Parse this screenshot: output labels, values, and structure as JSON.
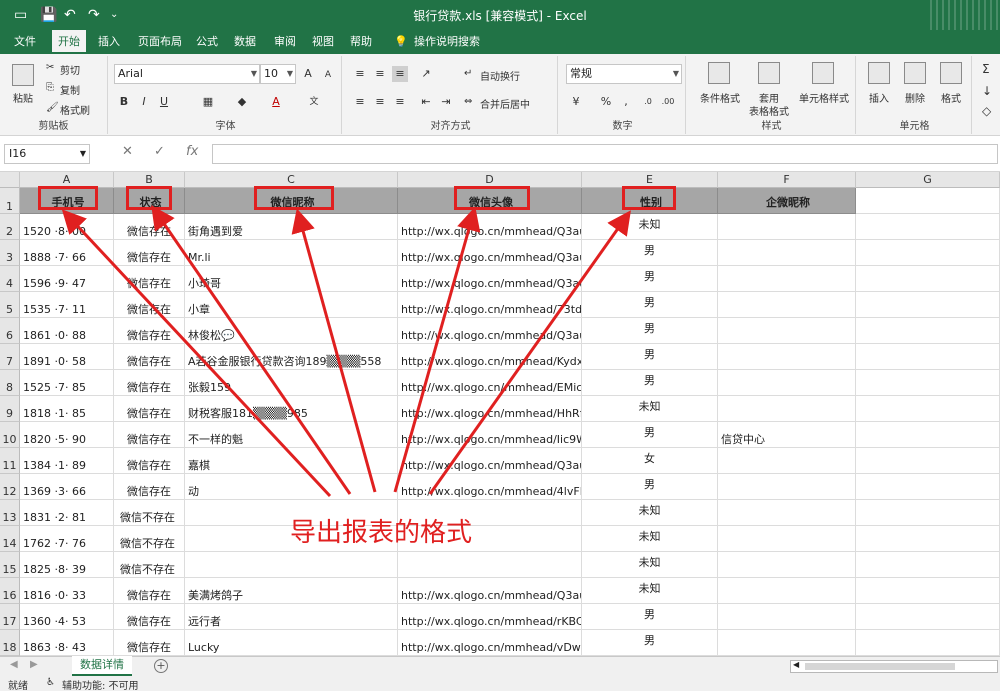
{
  "titlebar": {
    "title": "银行贷款.xls [兼容模式] - Excel"
  },
  "menu": {
    "tabs": [
      "文件",
      "开始",
      "插入",
      "页面布局",
      "公式",
      "数据",
      "审阅",
      "视图",
      "帮助"
    ],
    "active": "开始",
    "tell_me": "操作说明搜索"
  },
  "ribbon": {
    "clipboard": {
      "paste": "粘贴",
      "cut": "剪切",
      "copy": "复制",
      "format_painter": "格式刷",
      "label": "剪贴板"
    },
    "font": {
      "family": "Arial",
      "size": "10",
      "grow": "A",
      "shrink": "A",
      "bold": "B",
      "italic": "I",
      "underline": "U",
      "label": "字体"
    },
    "alignment": {
      "wrap": "自动换行",
      "merge": "合并后居中",
      "label": "对齐方式"
    },
    "number": {
      "format": "常规",
      "label": "数字"
    },
    "styles": {
      "conditional": "条件格式",
      "table_line1": "套用",
      "table_line2": "表格格式",
      "cell_styles": "单元格样式",
      "label": "样式"
    },
    "cells": {
      "insert": "插入",
      "delete": "删除",
      "format": "格式",
      "label": "单元格"
    }
  },
  "formula_bar": {
    "name_box": "I16",
    "cancel": "✕",
    "confirm": "✓",
    "fx": "fx",
    "value": ""
  },
  "grid": {
    "columns": [
      "A",
      "B",
      "C",
      "D",
      "E",
      "F",
      "G"
    ],
    "headers": [
      "手机号",
      "状态",
      "微信昵称",
      "微信头像",
      "性别",
      "企微昵称"
    ],
    "header_row": "1",
    "rows": [
      {
        "n": "2",
        "phone": "1520 ·8· 00",
        "status": "微信存在",
        "nick": "街角遇到爱",
        "avatar": "http://wx.qlogo.cn/mmhead/Q3auHgz",
        "gender": "未知",
        "wecom": ""
      },
      {
        "n": "3",
        "phone": "1888 ·7· 66",
        "status": "微信存在",
        "nick": "Mr.li",
        "avatar": "http://wx.qlogo.cn/mmhead/Q3auHgz",
        "gender": "男",
        "wecom": ""
      },
      {
        "n": "4",
        "phone": "1596 ·9· 47",
        "status": "微信存在",
        "nick": "小琦哥",
        "avatar": "http://wx.qlogo.cn/mmhead/Q3auHgz",
        "gender": "男",
        "wecom": ""
      },
      {
        "n": "5",
        "phone": "1535 ·7· 11",
        "status": "微信存在",
        "nick": "小章",
        "avatar": "http://wx.qlogo.cn/mmhead/73tdPWic",
        "gender": "男",
        "wecom": ""
      },
      {
        "n": "6",
        "phone": "1861 ·0· 88",
        "status": "微信存在",
        "nick": "林俊松💬",
        "avatar": "http://wx.qlogo.cn/mmhead/Q3auHgz",
        "gender": "男",
        "wecom": ""
      },
      {
        "n": "7",
        "phone": "1891 ·0· 58",
        "status": "微信存在",
        "nick": "A若谷金服银行贷款咨询189▒▒▒▒558",
        "avatar": "http://wx.qlogo.cn/mmhead/KydxAIB5",
        "gender": "男",
        "wecom": ""
      },
      {
        "n": "8",
        "phone": "1525 ·7· 85",
        "status": "微信存在",
        "nick": "张毅159",
        "avatar": "http://wx.qlogo.cn/mmhead/EMicH28",
        "gender": "男",
        "wecom": ""
      },
      {
        "n": "9",
        "phone": "1818 ·1· 85",
        "status": "微信存在",
        "nick": "财税客服181▒▒▒▒985",
        "avatar": "http://wx.qlogo.cn/mmhead/HhRfwka",
        "gender": "未知",
        "wecom": ""
      },
      {
        "n": "10",
        "phone": "1820 ·5· 90",
        "status": "微信存在",
        "nick": "不一样的魁",
        "avatar": "http://wx.qlogo.cn/mmhead/Iic9WLW",
        "gender": "男",
        "wecom": "信贷中心"
      },
      {
        "n": "11",
        "phone": "1384 ·1· 89",
        "status": "微信存在",
        "nick": "嘉棋",
        "avatar": "http://wx.qlogo.cn/mmhead/Q3auHgz",
        "gender": "女",
        "wecom": ""
      },
      {
        "n": "12",
        "phone": "1369 ·3· 66",
        "status": "微信存在",
        "nick": "动",
        "avatar": "http://wx.qlogo.cn/mmhead/4lvFKZkE",
        "gender": "男",
        "wecom": ""
      },
      {
        "n": "13",
        "phone": "1831 ·2· 81",
        "status": "微信不存在",
        "nick": "",
        "avatar": "",
        "gender": "未知",
        "wecom": ""
      },
      {
        "n": "14",
        "phone": "1762 ·7· 76",
        "status": "微信不存在",
        "nick": "",
        "avatar": "",
        "gender": "未知",
        "wecom": ""
      },
      {
        "n": "15",
        "phone": "1825 ·8· 39",
        "status": "微信不存在",
        "nick": "",
        "avatar": "",
        "gender": "未知",
        "wecom": ""
      },
      {
        "n": "16",
        "phone": "1816 ·0· 33",
        "status": "微信存在",
        "nick": "美满烤鸽子",
        "avatar": "http://wx.qlogo.cn/mmhead/Q3auHgz",
        "gender": "未知",
        "wecom": ""
      },
      {
        "n": "17",
        "phone": "1360 ·4· 53",
        "status": "微信存在",
        "nick": "远行者",
        "avatar": "http://wx.qlogo.cn/mmhead/rKBCaRc",
        "gender": "男",
        "wecom": ""
      },
      {
        "n": "18",
        "phone": "1863 ·8· 43",
        "status": "微信存在",
        "nick": "Lucky",
        "avatar": "http://wx.qlogo.cn/mmhead/vDwntJFb",
        "gender": "男",
        "wecom": ""
      }
    ]
  },
  "annotation": {
    "text": "导出报表的格式",
    "color": "#e02020"
  },
  "sheet_tabs": {
    "active": "数据详情",
    "add": "+"
  },
  "status": {
    "ready": "就绪",
    "accessibility": "辅助功能: 不可用"
  },
  "colors": {
    "excel_green": "#217346",
    "header_fill": "#a6a6a6",
    "annotation_red": "#e02020"
  }
}
